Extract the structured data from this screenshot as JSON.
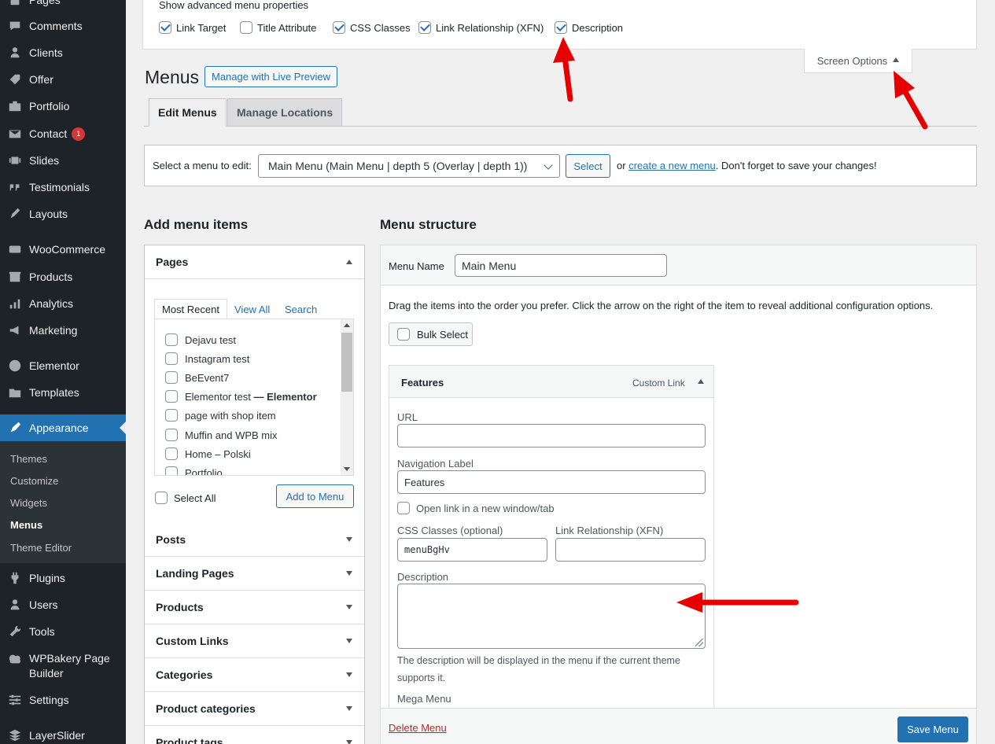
{
  "sidebar": {
    "items": [
      {
        "label": "Pages",
        "icon": "pages-icon"
      },
      {
        "label": "Comments",
        "icon": "comments-icon"
      },
      {
        "label": "Clients",
        "icon": "clients-icon"
      },
      {
        "label": "Offer",
        "icon": "offer-icon"
      },
      {
        "label": "Portfolio",
        "icon": "portfolio-icon"
      },
      {
        "label": "Contact",
        "icon": "contact-icon",
        "badge": "1"
      },
      {
        "label": "Slides",
        "icon": "slides-icon"
      },
      {
        "label": "Testimonials",
        "icon": "testimonials-icon"
      },
      {
        "label": "Layouts",
        "icon": "layouts-icon"
      },
      {
        "label": "WooCommerce",
        "icon": "woocommerce-icon"
      },
      {
        "label": "Products",
        "icon": "products-icon"
      },
      {
        "label": "Analytics",
        "icon": "analytics-icon"
      },
      {
        "label": "Marketing",
        "icon": "marketing-icon"
      },
      {
        "label": "Elementor",
        "icon": "elementor-icon"
      },
      {
        "label": "Templates",
        "icon": "templates-icon"
      },
      {
        "label": "Appearance",
        "icon": "appearance-icon",
        "active": true
      },
      {
        "label": "Plugins",
        "icon": "plugins-icon"
      },
      {
        "label": "Users",
        "icon": "users-icon"
      },
      {
        "label": "Tools",
        "icon": "tools-icon"
      },
      {
        "label": "WPBakery Page Builder",
        "icon": "wpbakery-icon"
      },
      {
        "label": "Settings",
        "icon": "settings-icon"
      },
      {
        "label": "LayerSlider",
        "icon": "layerslider-icon"
      }
    ],
    "submenu": [
      "Themes",
      "Customize",
      "Widgets",
      "Menus",
      "Theme Editor"
    ],
    "current_submenu": "Menus"
  },
  "screen_options": {
    "heading": "Show advanced menu properties",
    "checkboxes": [
      {
        "label": "Link Target",
        "checked": true
      },
      {
        "label": "Title Attribute",
        "checked": false
      },
      {
        "label": "CSS Classes",
        "checked": true
      },
      {
        "label": "Link Relationship (XFN)",
        "checked": true
      },
      {
        "label": "Description",
        "checked": true
      }
    ],
    "tab_label": "Screen Options"
  },
  "page": {
    "title": "Menus",
    "live_preview_label": "Manage with Live Preview",
    "tabs": [
      "Edit Menus",
      "Manage Locations"
    ]
  },
  "manage": {
    "label": "Select a menu to edit:",
    "selected_menu": "Main Menu (Main Menu | depth 5 (Overlay | depth 1))",
    "select_button": "Select",
    "or": "or",
    "create_link": "create a new menu",
    "tail": ". Don't forget to save your changes!"
  },
  "add_items": {
    "heading": "Add menu items",
    "pages_section": "Pages",
    "page_tabs": [
      "Most Recent",
      "View All",
      "Search"
    ],
    "pages": [
      "Dejavu test",
      "Instagram test",
      "BeEvent7",
      "Elementor test",
      "page with shop item",
      "Muffin and WPB mix",
      "Home – Polski",
      "Portfolio"
    ],
    "elementor_suffix": "— Elementor",
    "select_all": "Select All",
    "add_button": "Add to Menu",
    "sections": [
      "Posts",
      "Landing Pages",
      "Products",
      "Custom Links",
      "Categories",
      "Product categories",
      "Product tags"
    ]
  },
  "structure": {
    "heading": "Menu structure",
    "menu_name_label": "Menu Name",
    "menu_name_value": "Main Menu",
    "drag_text": "Drag the items into the order you prefer. Click the arrow on the right of the item to reveal additional configuration options.",
    "bulk_select": "Bulk Select",
    "item": {
      "title": "Features",
      "type": "Custom Link",
      "url_label": "URL",
      "url_value": "",
      "nav_label": "Navigation Label",
      "nav_value": "Features",
      "open_new": "Open link in a new window/tab",
      "css_label": "CSS Classes (optional)",
      "css_value": "menuBgHv",
      "xfn_label": "Link Relationship (XFN)",
      "xfn_value": "",
      "desc_label": "Description",
      "desc_help": "The description will be displayed in the menu if the current theme supports it.",
      "mega_menu": "Mega Menu"
    },
    "delete_menu": "Delete Menu",
    "save_menu": "Save Menu"
  },
  "colors": {
    "admin_bar": "#1d2327",
    "accent": "#2271b1",
    "annotation_arrow": "#e60000"
  }
}
